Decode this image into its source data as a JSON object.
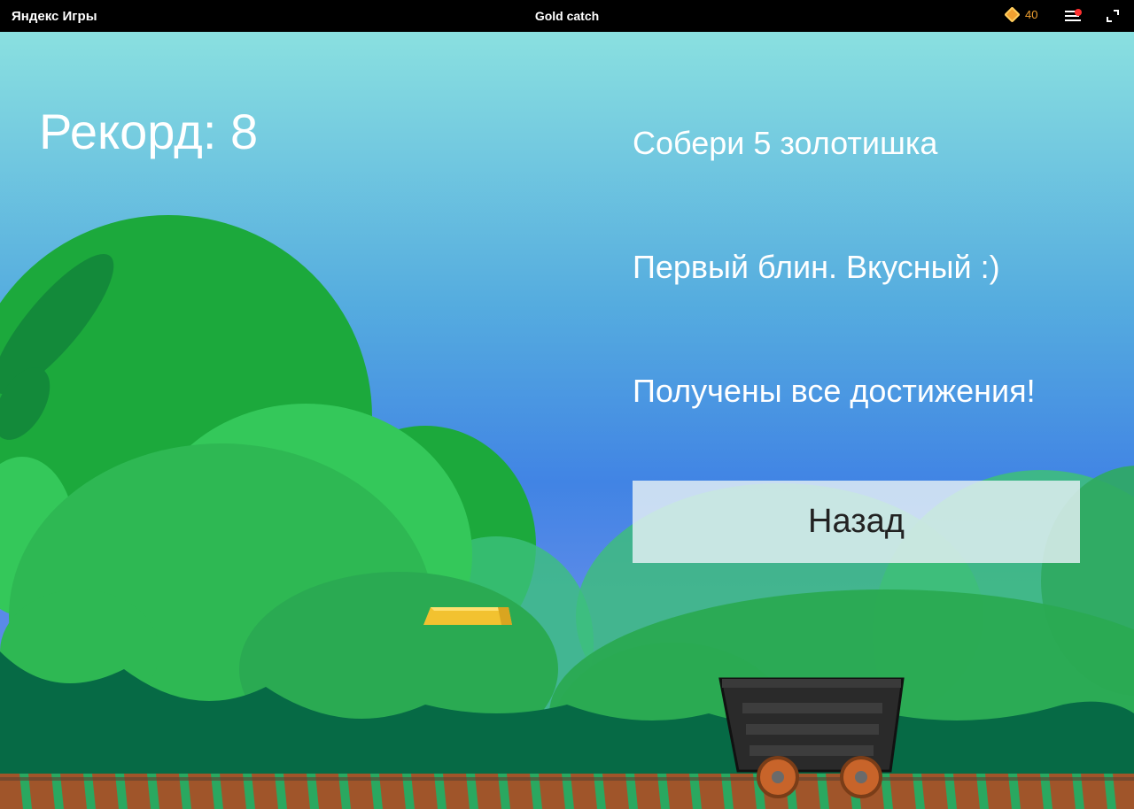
{
  "topbar": {
    "brand": "Яндекс Игры",
    "title": "Gold catch",
    "coins": "40",
    "icons": [
      "coin-icon",
      "menu-icon",
      "fullscreen-icon"
    ],
    "notification_color": "#ff3030"
  },
  "game": {
    "record": "Рекорд: 8",
    "achievements": [
      "Собери 5 золотишка",
      "Первый блин. Вкусный :)",
      "Получены все достижения!"
    ],
    "back_label": "Назад"
  },
  "colors": {
    "sky_top": "#8ae0e0",
    "sky_bottom": "#4184e4",
    "bush_dark": "#1ca93c",
    "bush_light": "#34c85a",
    "gold": "#f2c230",
    "rail": "#a0552a"
  }
}
